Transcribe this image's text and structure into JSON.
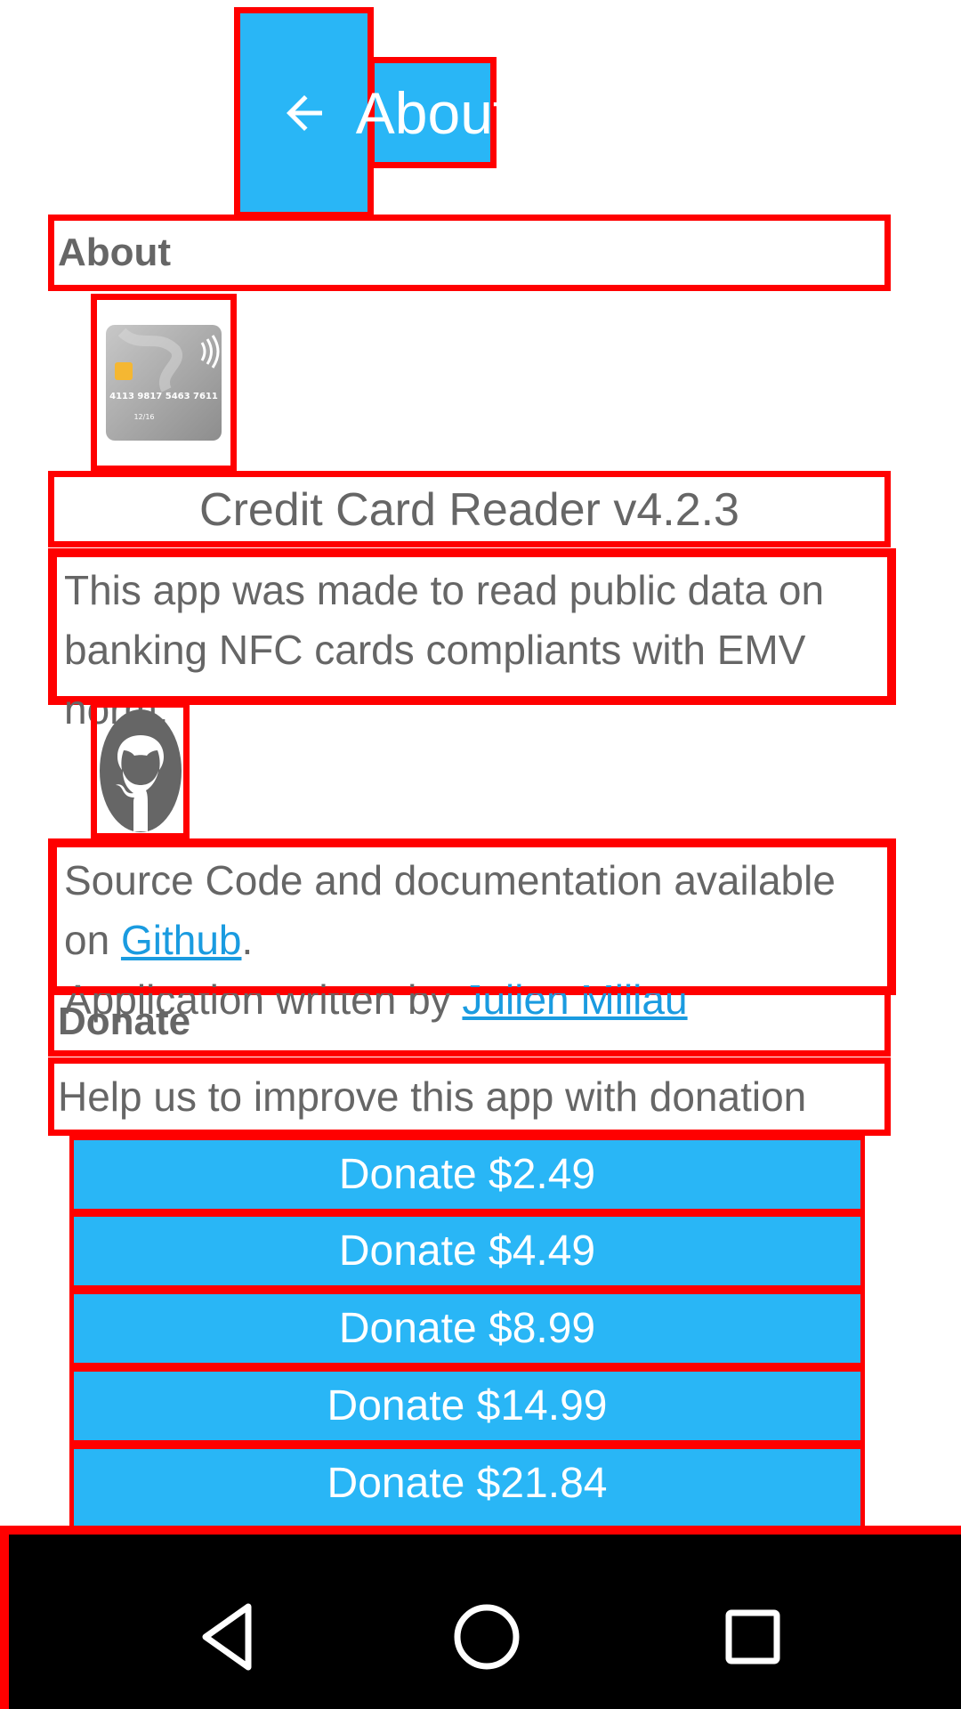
{
  "toolbar": {
    "back_icon": "arrow-left-icon",
    "title": "About"
  },
  "about_section": {
    "header": "About",
    "card_icon": "credit-card-icon",
    "card_number": "4113 9817 5463 7611",
    "card_expiry": "12/16",
    "version": "Credit Card Reader v4.2.3",
    "description": "This app was made to read public data on banking NFC cards compliants with EMV norm.",
    "github_icon": "github-icon",
    "source_prefix": "Source Code and documentation available on ",
    "github_link": "Github",
    "source_suffix": ".",
    "author_prefix": "Application written by ",
    "author_link": "Julien Millau"
  },
  "donate_section": {
    "header": "Donate",
    "text": "Help us to improve this app with donation",
    "buttons": [
      "Donate $2.49",
      "Donate $4.49",
      "Donate $8.99",
      "Donate $14.99",
      "Donate $21.84"
    ]
  },
  "nav_bar": {
    "back_icon": "triangle-back-icon",
    "home_icon": "circle-home-icon",
    "recents_icon": "square-recents-icon"
  },
  "colors": {
    "accent": "#29b6f6",
    "text": "#666666",
    "link": "#1a9be0",
    "annotation": "#ff0000"
  }
}
